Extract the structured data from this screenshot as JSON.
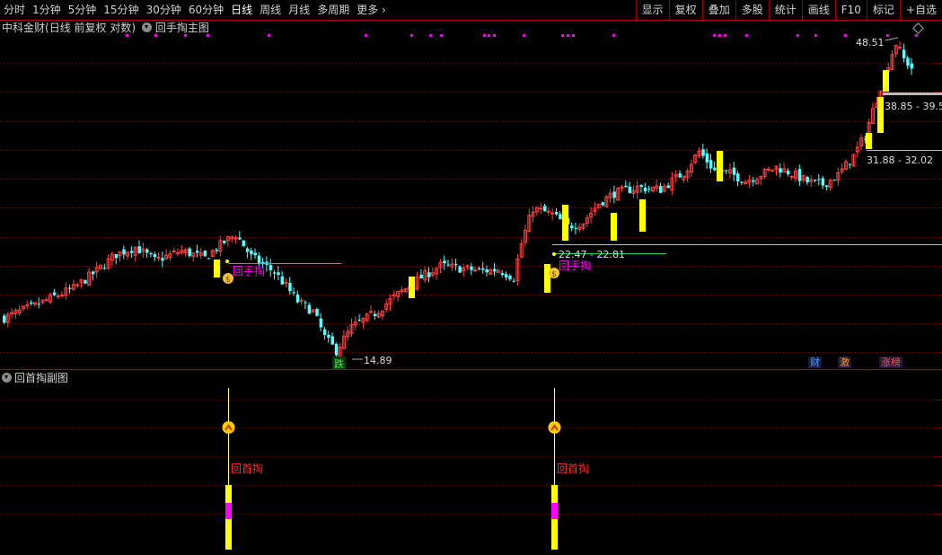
{
  "toolbar": {
    "periods": [
      {
        "label": "分时",
        "active": false
      },
      {
        "label": "1分钟",
        "active": false
      },
      {
        "label": "5分钟",
        "active": false
      },
      {
        "label": "15分钟",
        "active": false
      },
      {
        "label": "30分钟",
        "active": false
      },
      {
        "label": "60分钟",
        "active": false
      },
      {
        "label": "日线",
        "active": true
      },
      {
        "label": "周线",
        "active": false
      },
      {
        "label": "月线",
        "active": false
      },
      {
        "label": "多周期",
        "active": false
      },
      {
        "label": "更多",
        "active": false
      }
    ],
    "buttons": [
      "显示",
      "复权",
      "叠加",
      "多股",
      "统计",
      "画线",
      "F10",
      "标记",
      "+自选"
    ]
  },
  "main_panel": {
    "stock_name": "中科金财",
    "mode": "(日线 前复权 对数)",
    "indicator": "回手掏主图",
    "high_label": "48.51",
    "low_label": "14.89",
    "low_tag": "跌",
    "zone1_label": "22.47 - 22.81",
    "zone2_label": "31.88 - 32.02",
    "zone3_label": "38.85 - 39.5",
    "signal_label": "回手掏",
    "tags": [
      {
        "text": "财",
        "color": "#4aa0ff"
      },
      {
        "text": "激",
        "color": "#ff9a3c"
      },
      {
        "text": "涨榜",
        "color": "#ff5050"
      }
    ]
  },
  "sub_panel": {
    "title": "回首掏副图",
    "signal_label": "回首掏"
  },
  "colors": {
    "up": "#ff4040",
    "down": "#54ffff",
    "zone": "#ffff00",
    "grid": "#8b0000",
    "magenta": "#ff00ff"
  }
}
